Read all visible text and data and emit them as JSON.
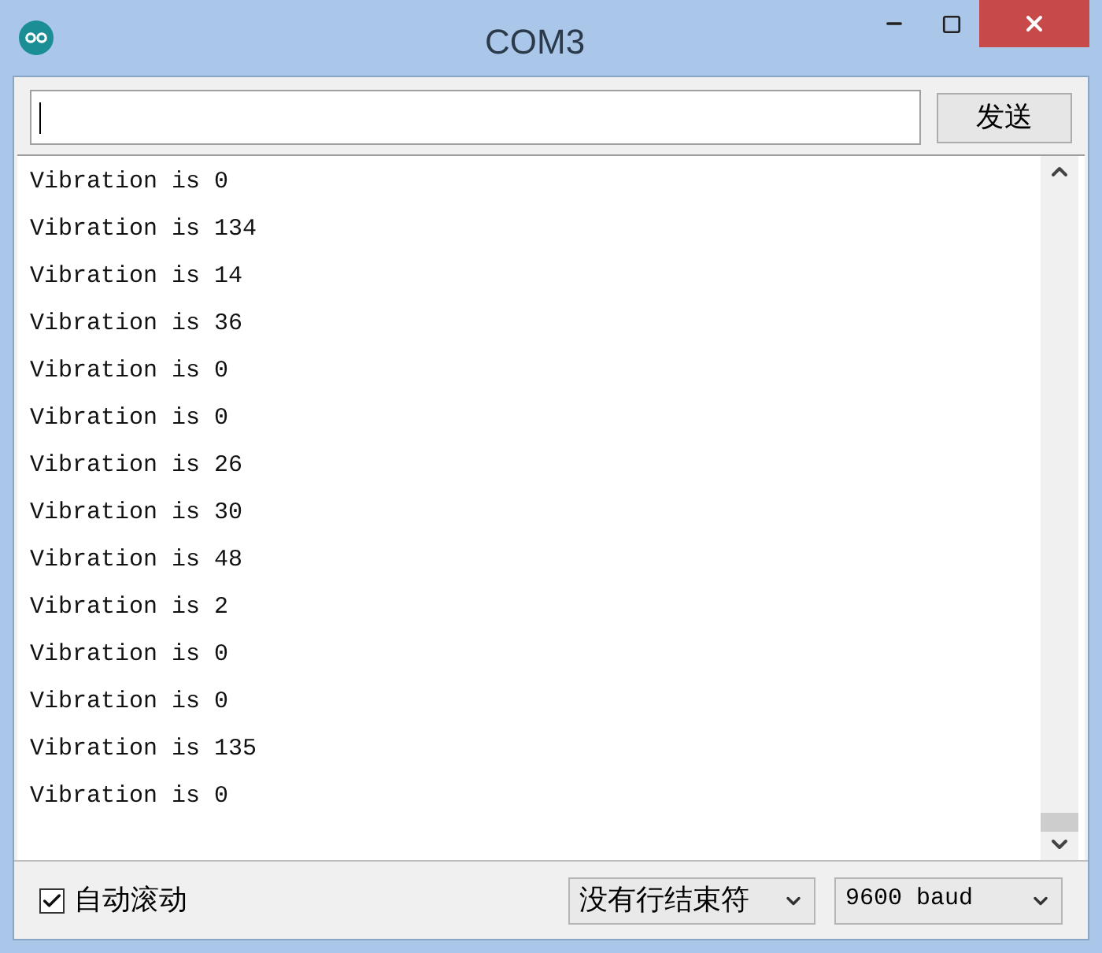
{
  "window": {
    "title": "COM3"
  },
  "input": {
    "send_button": "发送"
  },
  "output": {
    "lines": [
      "Vibration is 0",
      "Vibration is 134",
      "Vibration is 14",
      "Vibration is 36",
      "Vibration is 0",
      "Vibration is 0",
      "Vibration is 26",
      "Vibration is 30",
      "Vibration is 48",
      "Vibration is 2",
      "Vibration is 0",
      "Vibration is 0",
      "Vibration is 135",
      "Vibration is 0"
    ]
  },
  "footer": {
    "autoscroll": {
      "label": "自动滚动",
      "checked": true
    },
    "line_ending": "没有行结束符",
    "baud": "9600 baud"
  }
}
